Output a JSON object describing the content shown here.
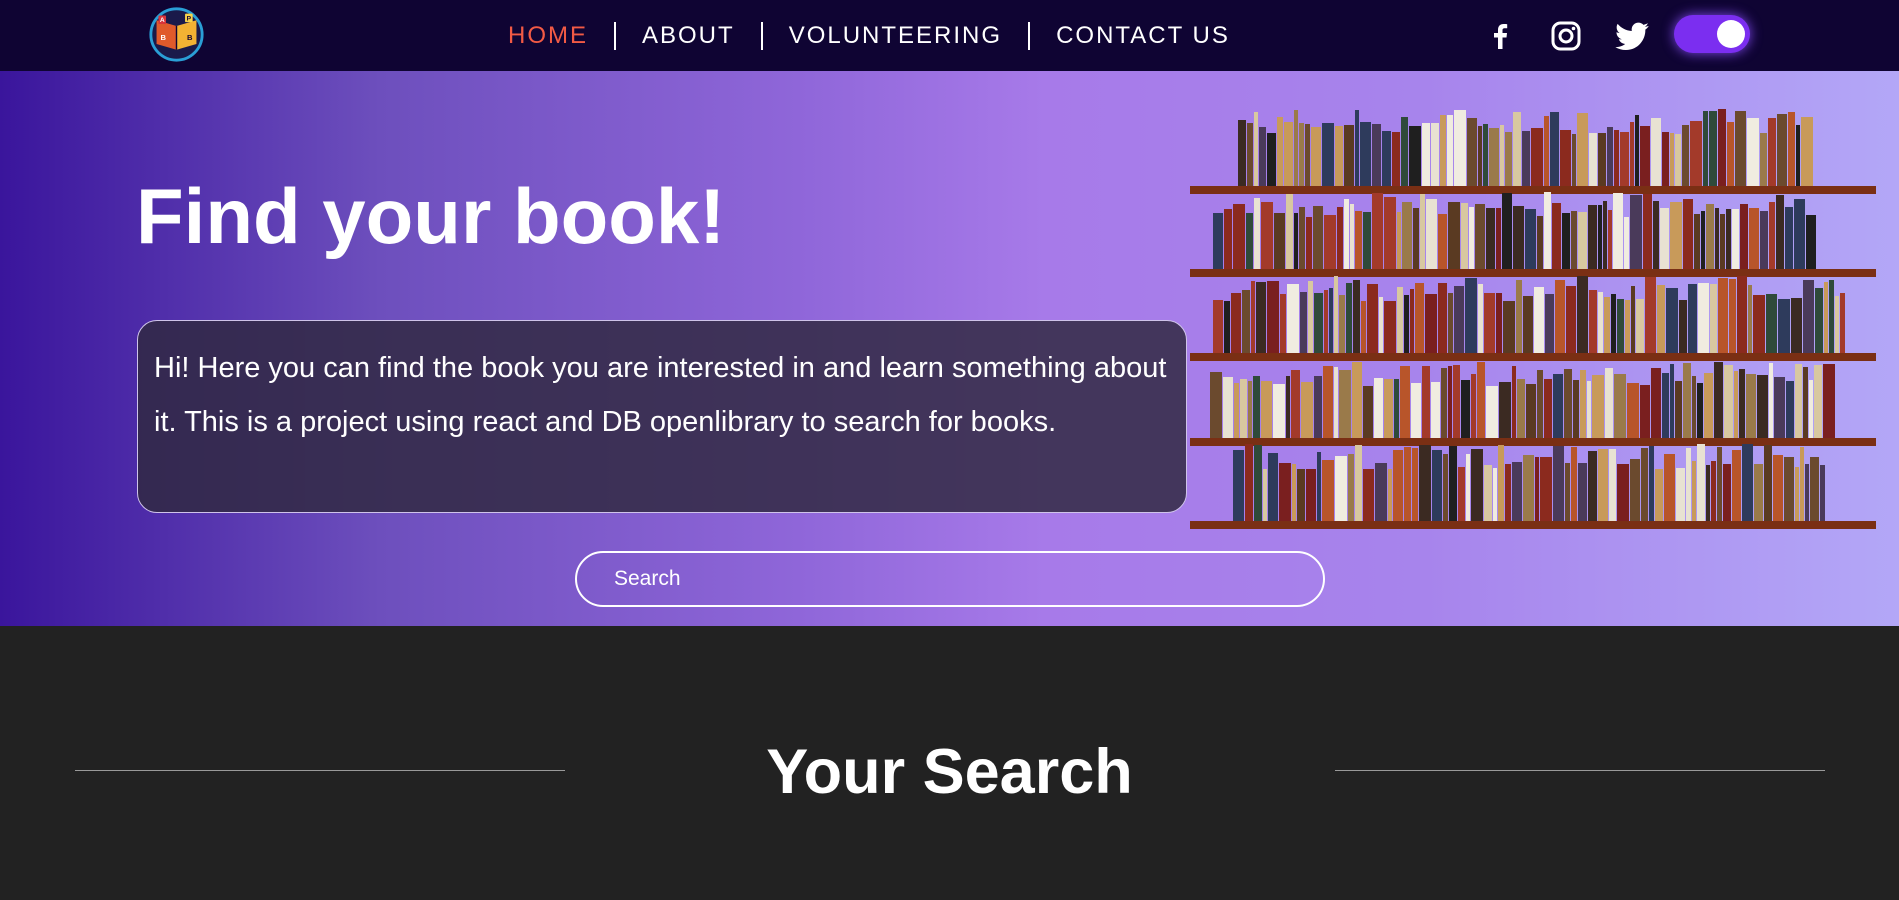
{
  "logo": {
    "letters": [
      "A",
      "B",
      "P",
      "B"
    ]
  },
  "nav": {
    "items": [
      {
        "label": "HOME",
        "active": true
      },
      {
        "label": "ABOUT",
        "active": false
      },
      {
        "label": "VOLUNTEERING",
        "active": false
      },
      {
        "label": "CONTACT US",
        "active": false
      }
    ]
  },
  "socials": [
    {
      "icon": "facebook-icon"
    },
    {
      "icon": "instagram-icon"
    },
    {
      "icon": "twitter-icon"
    }
  ],
  "theme_toggle": {
    "on": true,
    "color": "#7b2ef0"
  },
  "hero": {
    "title": "Find your book!",
    "intro": "Hi! Here you can find the book you are interested in and learn something about it. This is a project using react and DB openlibrary to search for books.",
    "search_placeholder": "Search"
  },
  "results": {
    "title": "Your Search"
  },
  "colors": {
    "navbar_bg": "#0f0433",
    "active_link": "#f25a45",
    "page_bg": "#222222",
    "hero_gradient_start": "#3a159c",
    "hero_gradient_end": "#b3a7f7"
  }
}
